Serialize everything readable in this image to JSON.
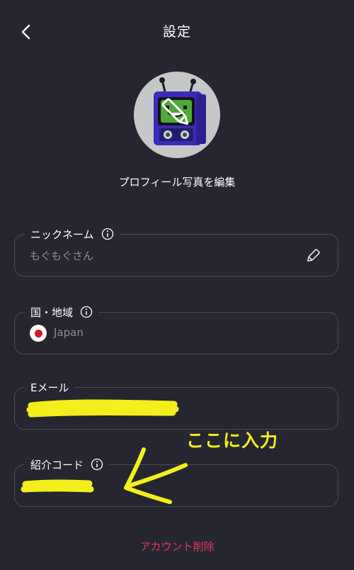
{
  "header": {
    "title": "設定",
    "back_icon": "chevron-left-icon"
  },
  "profile": {
    "edit_photo_label": "プロフィール写真を編集",
    "avatar_icon": "robot-avatar",
    "avatar_overlay_icon": "pencil-icon"
  },
  "fields": {
    "nickname": {
      "label": "ニックネーム",
      "value": "もぐもぐさん",
      "info_icon": "info-icon",
      "edit_icon": "pencil-icon"
    },
    "country": {
      "label": "国・地域",
      "value": "Japan",
      "flag_icon": "japan-flag-icon",
      "info_icon": "info-icon"
    },
    "email": {
      "label": "Eメール",
      "value_redacted": true
    },
    "referral": {
      "label": "紹介コード",
      "value_redacted": true,
      "info_icon": "info-icon"
    }
  },
  "footer": {
    "delete_account_label": "アカウント削除"
  },
  "annotation": {
    "text": "ここに入力",
    "color": "#f4ee1c",
    "arrow_icon": "hand-drawn-arrow-left-icon"
  },
  "colors": {
    "background": "#262631",
    "border": "#4a4a58",
    "placeholder_text": "#8d8d99",
    "danger": "#e6365e",
    "annotation": "#f4ee1c"
  }
}
